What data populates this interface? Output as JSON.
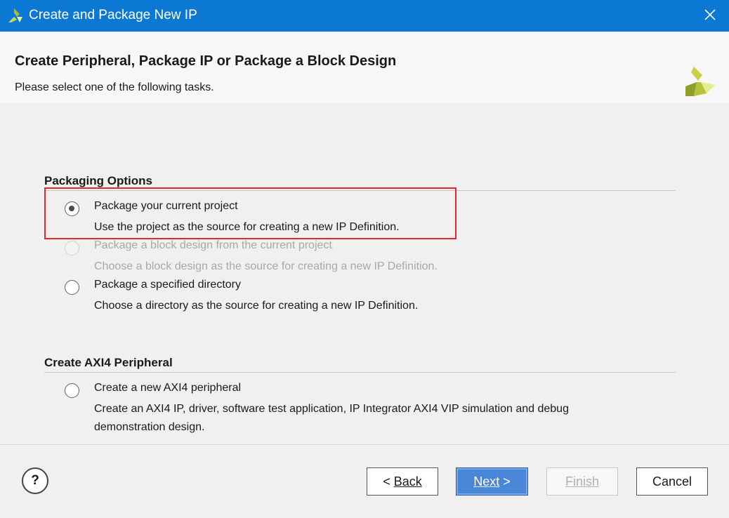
{
  "window": {
    "title": "Create and Package New IP"
  },
  "header": {
    "title": "Create Peripheral, Package IP or Package a Block Design",
    "subtitle": "Please select one of the following tasks."
  },
  "packaging": {
    "title": "Packaging Options",
    "options": [
      {
        "label": "Package your current project",
        "description": "Use the project as the source for creating a new IP Definition.",
        "selected": true,
        "enabled": true
      },
      {
        "label": "Package a block design from the current project",
        "description": "Choose a block design as the source for creating a new IP Definition.",
        "selected": false,
        "enabled": false
      },
      {
        "label": "Package a specified directory",
        "description": "Choose a directory as the source for creating a new IP Definition.",
        "selected": false,
        "enabled": true
      }
    ]
  },
  "axi": {
    "title": "Create AXI4 Peripheral",
    "options": [
      {
        "label": "Create a new AXI4 peripheral",
        "description_line1": "Create an AXI4 IP, driver, software test application, IP Integrator AXI4 VIP simulation and debug",
        "description_line2": "demonstration design.",
        "selected": false,
        "enabled": true
      }
    ]
  },
  "footer": {
    "help_label": "?",
    "back_prefix": "< ",
    "back_label": "Back",
    "next_label": "Next",
    "next_suffix": " >",
    "finish_label": "Finish",
    "cancel_label": "Cancel"
  },
  "colors": {
    "titlebar": "#0b78d4",
    "highlight": "#e32b24",
    "primary_button": "#4a86d8"
  }
}
